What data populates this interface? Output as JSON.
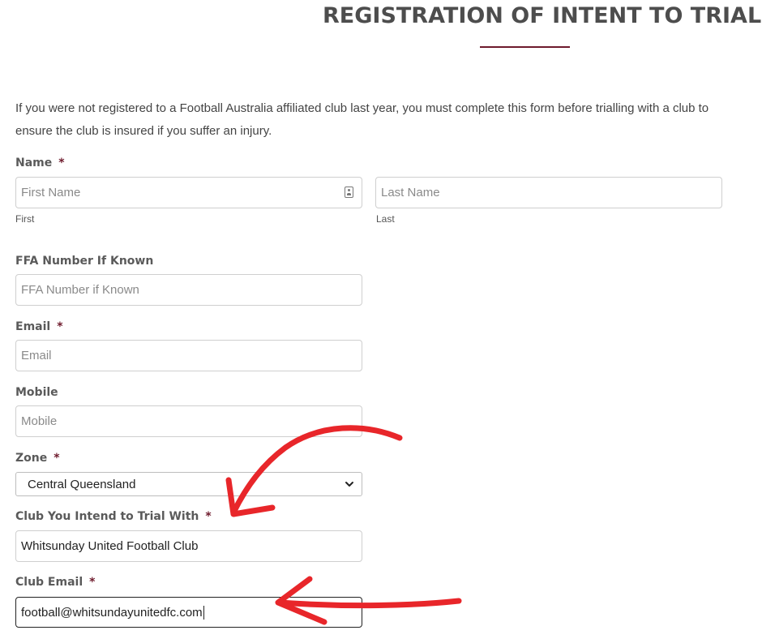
{
  "page": {
    "title": "REGISTRATION OF INTENT TO TRIAL",
    "intro": "If you were not registered to a Football Australia affiliated club last year, you must complete this form before trialling with a club to ensure the club is insured if you suffer an injury."
  },
  "form": {
    "required_mark": "*",
    "name": {
      "label": "Name",
      "first_placeholder": "First Name",
      "first_sublabel": "First",
      "last_placeholder": "Last Name",
      "last_sublabel": "Last"
    },
    "ffa": {
      "label": "FFA Number If Known",
      "placeholder": "FFA Number if Known"
    },
    "email": {
      "label": "Email",
      "placeholder": "Email"
    },
    "mobile": {
      "label": "Mobile",
      "placeholder": "Mobile"
    },
    "zone": {
      "label": "Zone",
      "selected": "Central Queensland"
    },
    "club": {
      "label": "Club You Intend to Trial With",
      "value": "Whitsunday United Football Club"
    },
    "club_email": {
      "label": "Club Email",
      "value": "football@whitsundayunitedfc.com"
    }
  },
  "colors": {
    "accent": "#6e1a2c",
    "annotation_arrow": "#e8262a"
  },
  "icons": [
    "contact-card-icon",
    "chevron-down-icon"
  ],
  "annotations": [
    "red-arrow-to-club-field",
    "red-arrow-to-club-email-field"
  ]
}
